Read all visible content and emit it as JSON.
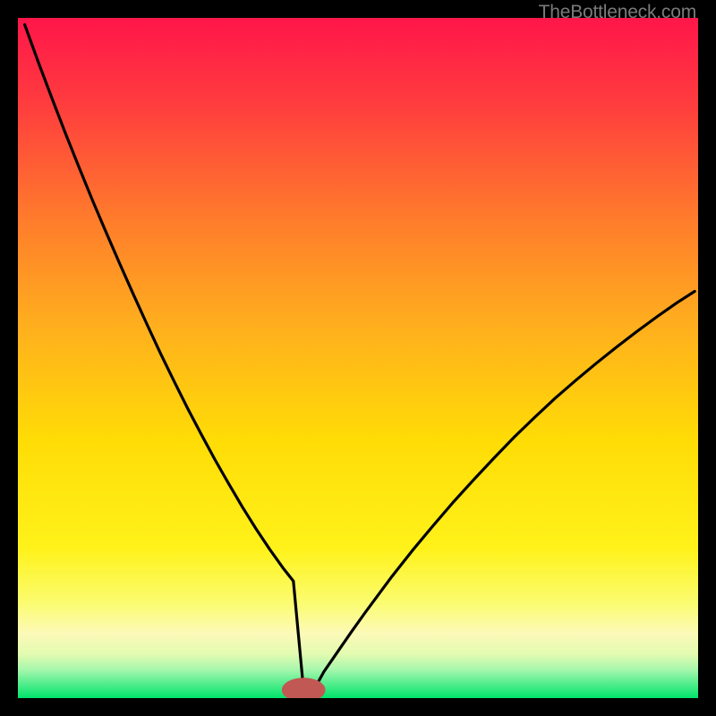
{
  "watermark": "TheBottleneck.com",
  "chart_data": {
    "type": "line",
    "title": "",
    "xlabel": "",
    "ylabel": "",
    "xlim": [
      0,
      100
    ],
    "ylim": [
      0,
      100
    ],
    "grid": false,
    "background_gradient": {
      "top": "#ff164a",
      "mid_upper": "#ffa520",
      "mid": "#ffe000",
      "lower_band": "#fdfaa8",
      "green_band": "#9cf8b0",
      "bottom": "#00e46a"
    },
    "marker": {
      "x": 42,
      "y": 1.2,
      "color": "#c15854",
      "rx": 3.2,
      "ry": 1.8
    },
    "series": [
      {
        "name": "bottleneck-curve",
        "color": "#000000",
        "x": [
          1,
          3,
          5,
          7,
          9,
          11,
          13,
          15,
          17,
          19,
          21,
          23,
          25,
          27,
          29,
          31,
          33,
          35,
          37,
          39,
          40.5,
          42,
          43.5,
          45,
          47,
          49,
          51,
          53,
          55,
          58,
          61,
          64,
          67,
          70,
          73,
          76,
          79,
          82,
          85,
          88,
          91,
          94,
          97,
          99.5
        ],
        "y": [
          99,
          93.5,
          88.2,
          83,
          78,
          73.1,
          68.4,
          63.8,
          59.3,
          54.9,
          50.6,
          46.5,
          42.5,
          38.7,
          35,
          31.5,
          28.1,
          24.9,
          21.9,
          19.1,
          17.2,
          1.2,
          1.2,
          3.9,
          6.8,
          9.7,
          12.5,
          15.2,
          17.9,
          21.7,
          25.3,
          28.8,
          32.1,
          35.3,
          38.4,
          41.3,
          44.1,
          46.7,
          49.2,
          51.6,
          53.9,
          56.1,
          58.2,
          59.8
        ]
      }
    ],
    "notes": "V-shaped bottleneck curve over a vertical hue gradient (red→orange→yellow→pale→green). Optimal point (curve minimum) sits near x≈42 at the green floor, marked by a small rounded burgundy dot."
  }
}
